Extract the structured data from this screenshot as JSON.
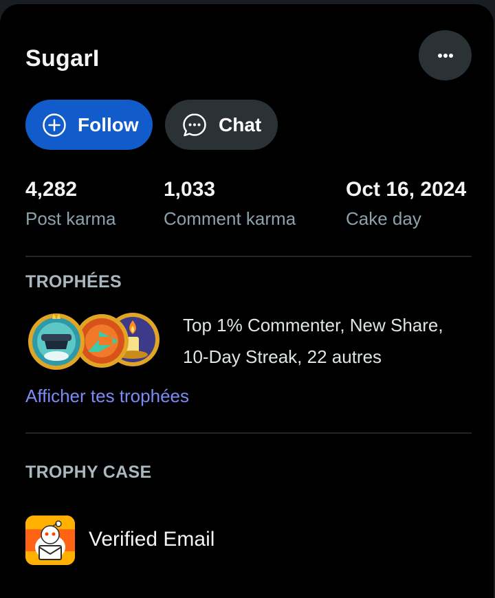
{
  "profile": {
    "username": "SugarI",
    "more_icon": "ellipsis-icon"
  },
  "actions": {
    "follow_label": "Follow",
    "follow_icon": "plus-circle-icon",
    "chat_label": "Chat",
    "chat_icon": "chat-bubble-icon"
  },
  "stats": [
    {
      "value": "4,282",
      "label": "Post karma"
    },
    {
      "value": "1,033",
      "label": "Comment karma"
    },
    {
      "value": "Oct 16, 2024",
      "label": "Cake day"
    }
  ],
  "trophies": {
    "title": "TROPHÉES",
    "summary_line1": "Top 1% Commenter, New Share,",
    "summary_line2": "10-Day Streak, 22 autres",
    "link": "Afficher tes trophées",
    "icons": [
      "top-commenter-trophy-icon",
      "new-share-trophy-icon",
      "streak-candle-trophy-icon"
    ]
  },
  "trophy_case": {
    "title": "TROPHY CASE",
    "items": [
      {
        "label": "Verified Email",
        "icon": "verified-email-icon"
      }
    ]
  },
  "colors": {
    "accent_blue": "#115bca",
    "link": "#7c8cf6",
    "background": "#000000",
    "button_gray": "#2a3236"
  }
}
